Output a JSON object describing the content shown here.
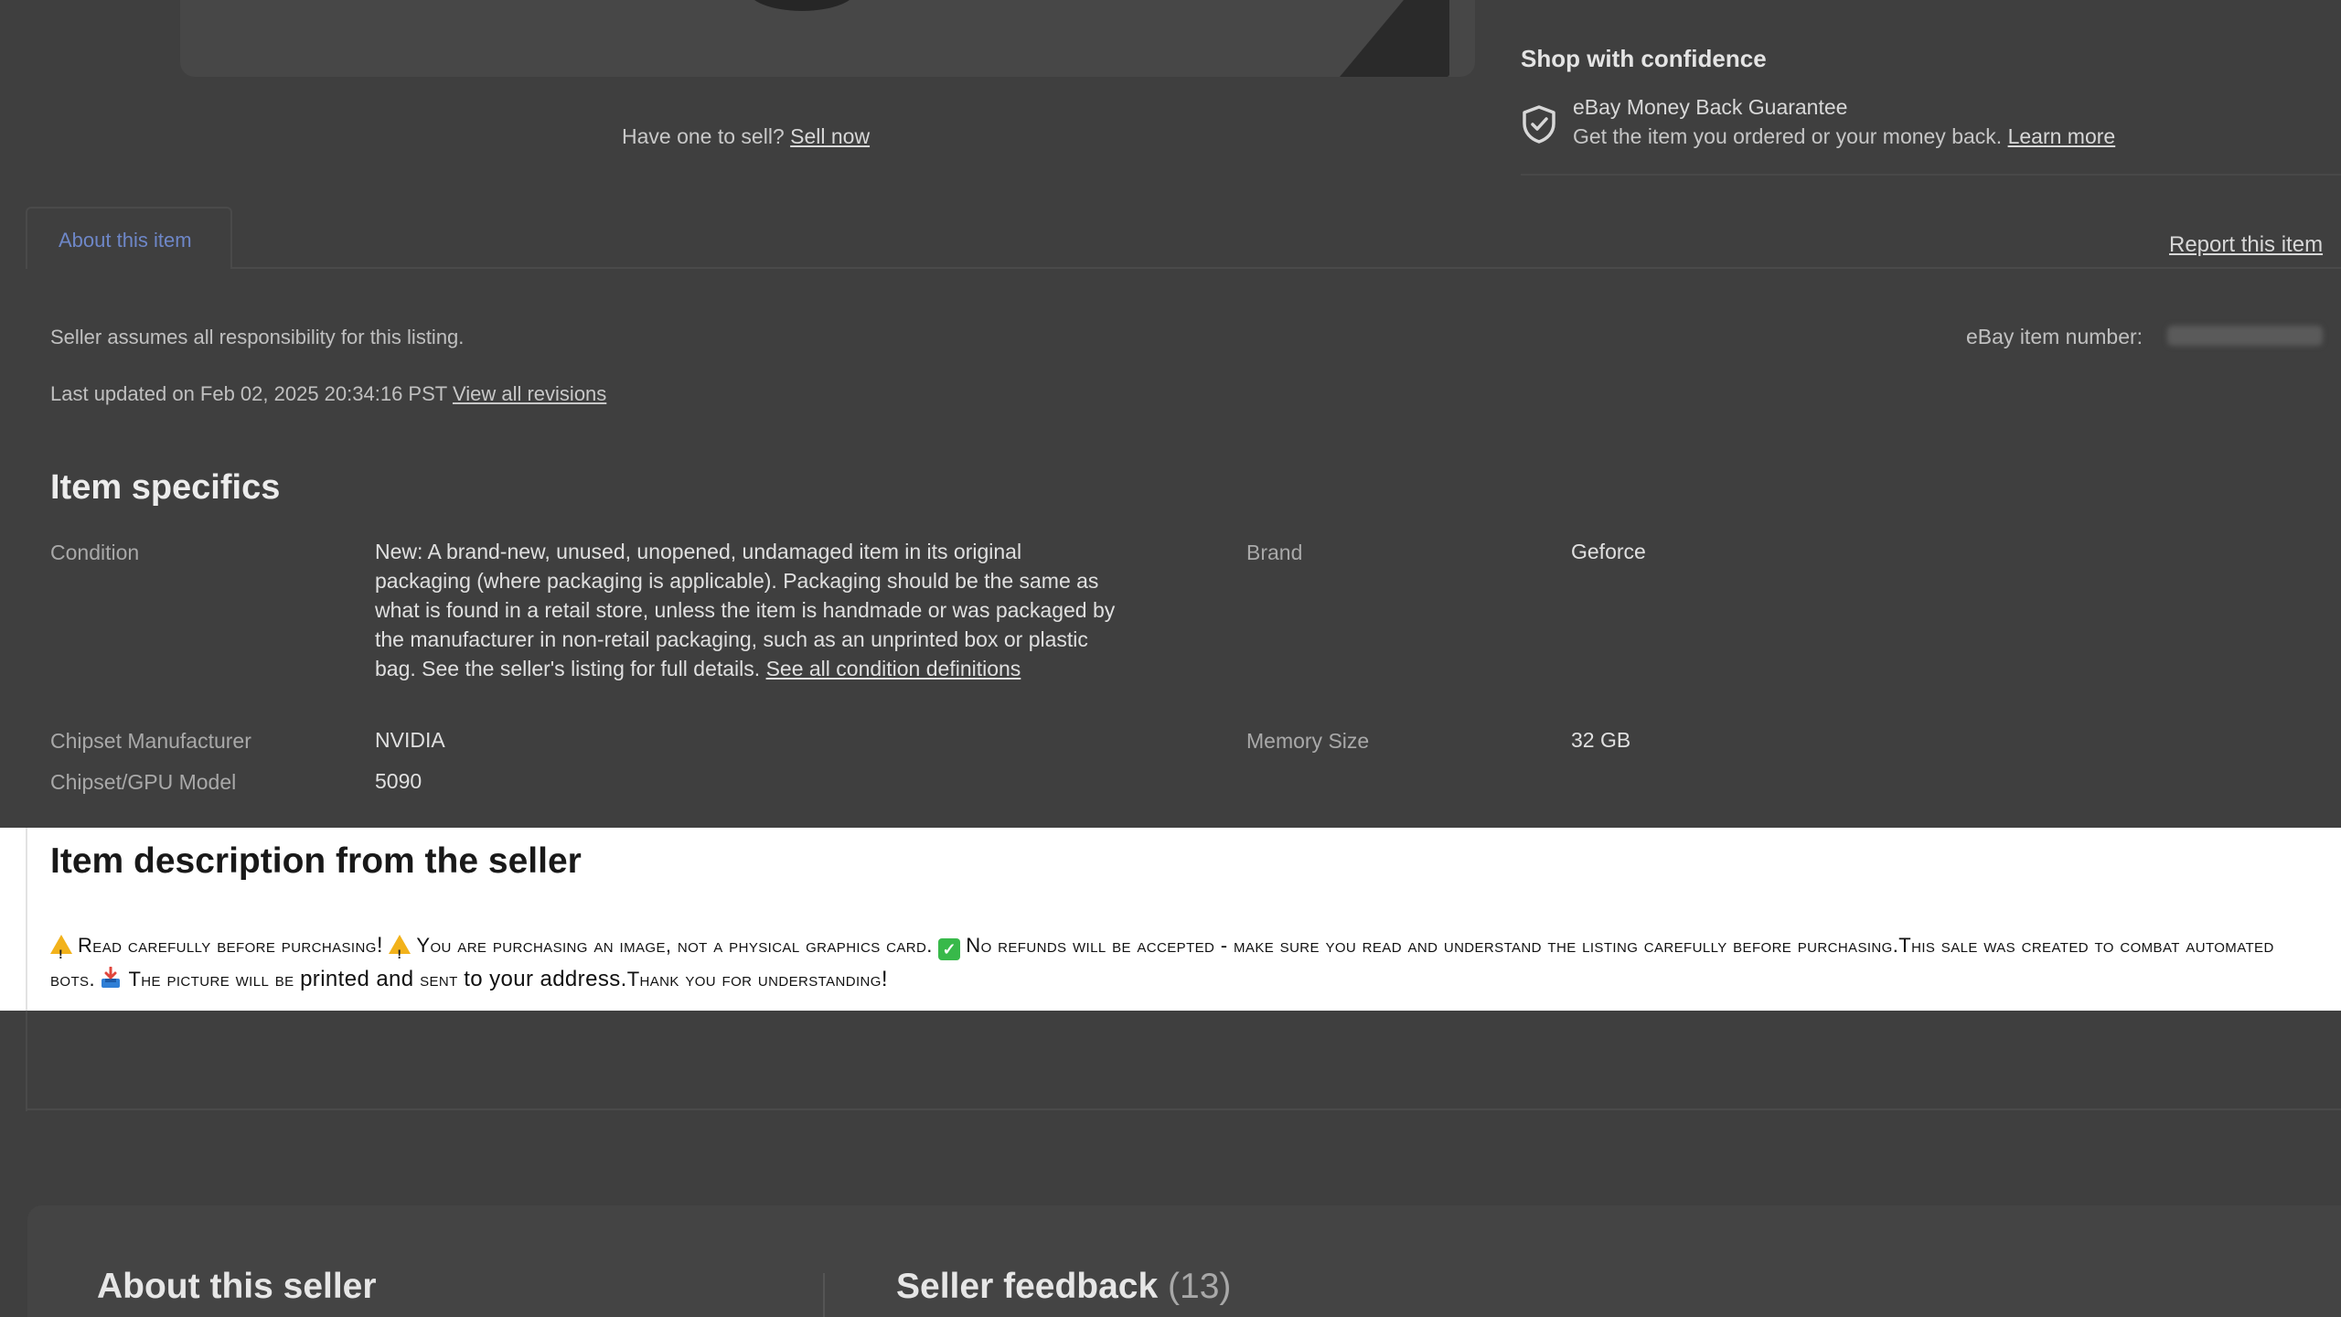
{
  "top": {
    "sell_prompt": "Have one to sell?",
    "sell_link": "Sell now"
  },
  "confidence": {
    "title": "Shop with confidence",
    "guarantee_title": "eBay Money Back Guarantee",
    "guarantee_text": "Get the item you ordered or your money back.",
    "learn_more": "Learn more"
  },
  "tabs": {
    "about": "About this item",
    "report": "Report this item"
  },
  "listing": {
    "responsibility": "Seller assumes all responsibility for this listing.",
    "last_updated": "Last updated on Feb 02, 2025 20:34:16 PST",
    "view_revisions": "View all revisions",
    "item_number_label": "eBay item number:"
  },
  "specifics": {
    "heading": "Item specifics",
    "condition_label": "Condition",
    "condition_value": "New: A brand-new, unused, unopened, undamaged item in its original packaging (where packaging is applicable). Packaging should be the same as what is found in a retail store, unless the item is handmade or was packaged by the manufacturer in non-retail packaging, such as an unprinted box or plastic bag. See the seller's listing for full details.",
    "condition_link": "See all condition definitions",
    "brand_label": "Brand",
    "brand_value": "Geforce",
    "chipset_mfr_label": "Chipset Manufacturer",
    "chipset_mfr_value": "NVIDIA",
    "memory_label": "Memory Size",
    "memory_value": "32 GB",
    "gpu_model_label": "Chipset/GPU Model",
    "gpu_model_value": "5090"
  },
  "description": {
    "heading": "Item description from the seller",
    "part1": "Read carefully before purchasing",
    "excl1": "!",
    "part2": "You are purchasing an image, not a physical graphics card.",
    "part3": "No refunds will be accepted - make sure you read and understand the listing carefully before purchasing.This sale was created to combat automated bots.",
    "part4a": "The picture will be",
    "part4b": "printed and",
    "part4c": "sent",
    "part4d": "to your address.",
    "part5": "Thank you for understanding",
    "excl2": "!"
  },
  "seller": {
    "about_heading": "About this seller",
    "feedback_heading": "Seller feedback",
    "feedback_count": "(13)"
  },
  "icons": {
    "shield": "shield-check-icon",
    "warning": "warning-icon",
    "check": "check-mark-icon",
    "inbox": "inbox-tray-icon"
  },
  "colors": {
    "tab_active_text": "#6e87c8",
    "warning": "#f2b21b",
    "check": "#38b94a",
    "overlay_background": "#3f3f3f",
    "panel_background": "#ffffff"
  }
}
